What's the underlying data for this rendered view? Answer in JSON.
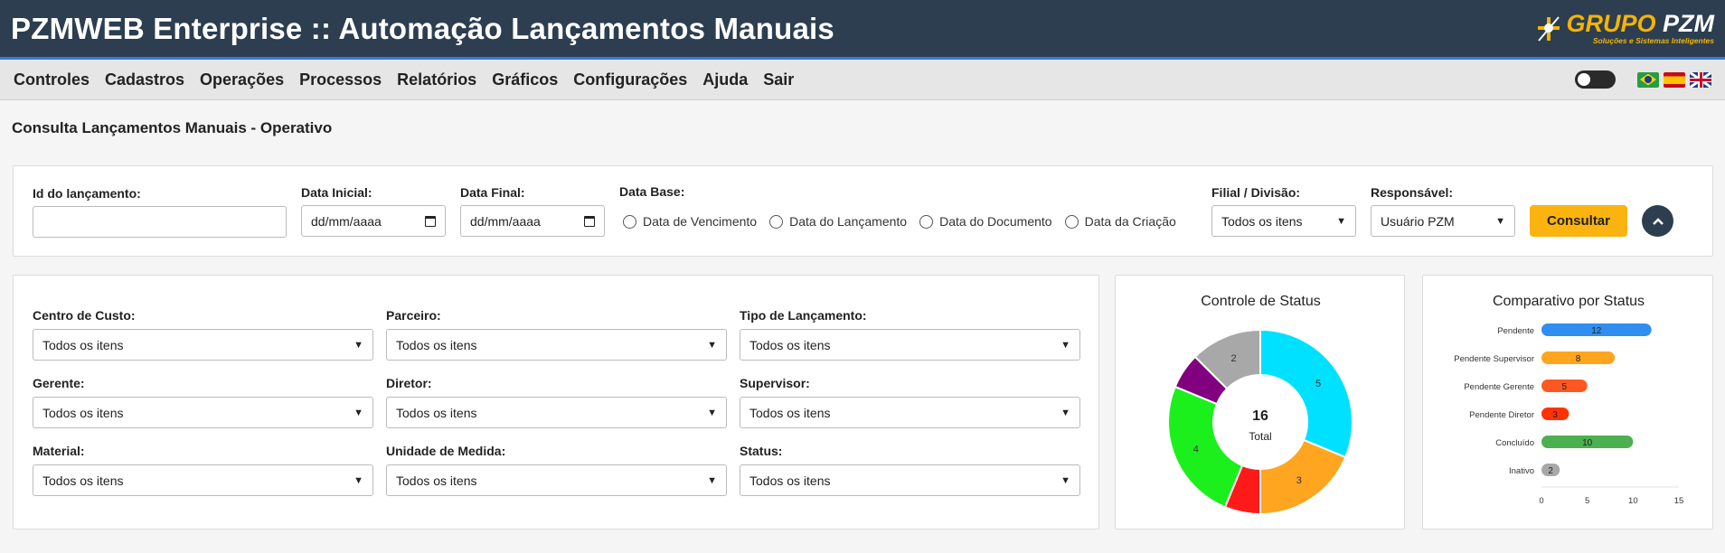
{
  "header": {
    "title": "PZMWEB Enterprise :: Automação Lançamentos Manuais",
    "logo_main": "GRUPO",
    "logo_main2": "PZM",
    "logo_sub": "Soluções e Sistemas Inteligentes"
  },
  "menu": {
    "items": [
      "Controles",
      "Cadastros",
      "Operações",
      "Processos",
      "Relatórios",
      "Gráficos",
      "Configurações",
      "Ajuda",
      "Sair"
    ]
  },
  "page": {
    "title": "Consulta Lançamentos Manuais - Operativo"
  },
  "filters_top": {
    "id_label": "Id do lançamento:",
    "id_value": "",
    "data_inicial_label": "Data Inicial:",
    "data_inicial_value": "dd/mm/aaaa",
    "data_final_label": "Data Final:",
    "data_final_value": "dd/mm/aaaa",
    "data_base_label": "Data Base:",
    "data_base_options": [
      "Data de Vencimento",
      "Data do Lançamento",
      "Data do Documento",
      "Data da Criação"
    ],
    "filial_label": "Filial / Divisão:",
    "filial_value": "Todos os itens",
    "responsavel_label": "Responsável:",
    "responsavel_value": "Usuário PZM",
    "consultar_label": "Consultar"
  },
  "filters_grid": {
    "centro_custo_label": "Centro de Custo:",
    "parceiro_label": "Parceiro:",
    "tipo_lancamento_label": "Tipo de Lançamento:",
    "gerente_label": "Gerente:",
    "diretor_label": "Diretor:",
    "supervisor_label": "Supervisor:",
    "material_label": "Material:",
    "unidade_label": "Unidade de Medida:",
    "status_label": "Status:",
    "default_value": "Todos os itens"
  },
  "chart_data": [
    {
      "type": "pie",
      "title": "Controle de Status",
      "center_value": "16",
      "center_label": "Total",
      "slices": [
        {
          "label": "",
          "value": 5,
          "color": "#00e1ff"
        },
        {
          "label": "",
          "value": 3,
          "color": "#ffa51f"
        },
        {
          "label": "",
          "value": 1,
          "color": "#ff1a1a"
        },
        {
          "label": "",
          "value": 4,
          "color": "#1cf01c"
        },
        {
          "label": "",
          "value": 1,
          "color": "#800080"
        },
        {
          "label": "",
          "value": 2,
          "color": "#a8a8a8"
        }
      ]
    },
    {
      "type": "bar",
      "orientation": "horizontal",
      "title": "Comparativo por Status",
      "categories": [
        "Pendente",
        "Pendente Supervisor",
        "Pendente Gerente",
        "Pendente Diretor",
        "Concluído",
        "Inativo"
      ],
      "values": [
        12,
        8,
        5,
        3,
        10,
        2
      ],
      "colors": [
        "#2f8ef0",
        "#ffa51f",
        "#ff5722",
        "#ff3300",
        "#4caf50",
        "#a8a8a8"
      ],
      "xlim": [
        0,
        15
      ],
      "xticks": [
        0,
        5,
        10,
        15
      ]
    }
  ]
}
